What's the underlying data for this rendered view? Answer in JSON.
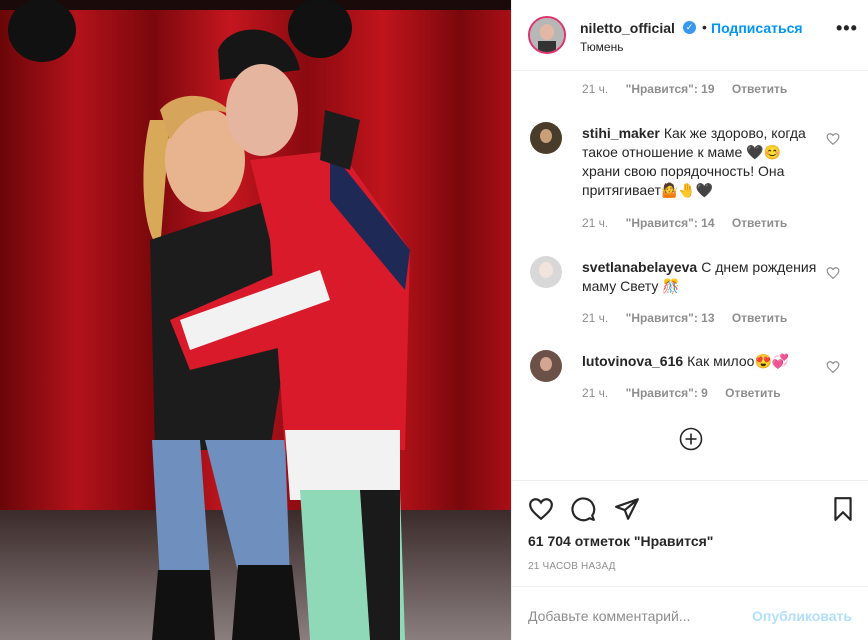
{
  "post": {
    "username": "niletto_official",
    "dot": "•",
    "follow_label": "Подписаться",
    "location": "Тюмень",
    "more_label": "•••"
  },
  "comments": [
    {
      "time": "21 ч.",
      "likes": "\"Нравится\": 19",
      "reply": "Ответить"
    },
    {
      "username": "stihi_maker",
      "text": "Как же здорово, когда такое отношение к маме 🖤😊 храни свою порядочность! Она притягивает🤷🤚🖤",
      "time": "21 ч.",
      "likes": "\"Нравится\": 14",
      "reply": "Ответить"
    },
    {
      "username": "svetlanabelayeva",
      "text": "С днем рождения маму Свету 🎊",
      "time": "21 ч.",
      "likes": "\"Нравится\": 13",
      "reply": "Ответить"
    },
    {
      "username": "lutovinova_616",
      "text": "Как милоо😍💞",
      "time": "21 ч.",
      "likes": "\"Нравится\": 9",
      "reply": "Ответить"
    }
  ],
  "likes_count": "61 704 отметок \"Нравится\"",
  "time_ago": "21 ЧАСОВ НАЗАД",
  "add_comment": {
    "placeholder": "Добавьте комментарий...",
    "publish_label": "Опубликовать"
  },
  "colors": {
    "accent": "#0095f6",
    "publish_disabled": "#b2dffc",
    "muted": "#8e8e8e"
  },
  "icons": [
    "heart-icon",
    "comment-icon",
    "share-icon",
    "bookmark-icon",
    "add-circle-icon",
    "verified-icon"
  ]
}
